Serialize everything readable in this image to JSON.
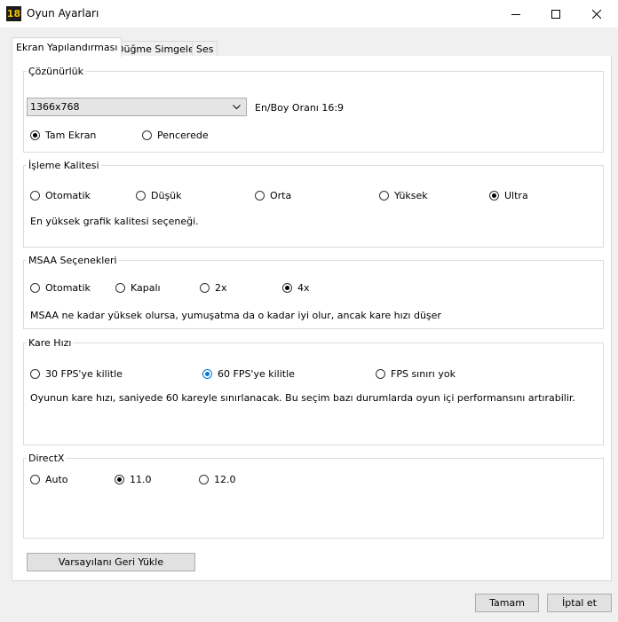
{
  "window": {
    "title": "Oyun Ayarları",
    "icon_text": "18",
    "controls": [
      "minimize-icon",
      "maximize-icon",
      "close-icon"
    ]
  },
  "tabs": [
    {
      "label": "Ekran Yapılandırması",
      "active": true
    },
    {
      "label": "Düğme Simgeleri",
      "active": false
    },
    {
      "label": "Ses",
      "active": false
    }
  ],
  "resolution": {
    "group_label": "Çözünürlük",
    "selected": "1366x768",
    "aspect_ratio": "En/Boy Oranı 16:9",
    "modes": [
      {
        "label": "Tam Ekran",
        "checked": true
      },
      {
        "label": "Pencerede",
        "checked": false
      }
    ]
  },
  "quality": {
    "group_label": "İşleme Kalitesi",
    "options": [
      {
        "label": "Otomatik",
        "checked": false
      },
      {
        "label": "Düşük",
        "checked": false
      },
      {
        "label": "Orta",
        "checked": false
      },
      {
        "label": "Yüksek",
        "checked": false
      },
      {
        "label": "Ultra",
        "checked": true
      }
    ],
    "description": "En yüksek grafik kalitesi seçeneği."
  },
  "msaa": {
    "group_label": "MSAA Seçenekleri",
    "options": [
      {
        "label": "Otomatik",
        "checked": false
      },
      {
        "label": "Kapalı",
        "checked": false
      },
      {
        "label": "2x",
        "checked": false
      },
      {
        "label": "4x",
        "checked": true
      }
    ],
    "description": "MSAA ne kadar yüksek olursa, yumuşatma da o kadar iyi olur, ancak kare hızı düşer"
  },
  "framerate": {
    "group_label": "Kare Hızı",
    "options": [
      {
        "label": "30 FPS'ye kilitle",
        "checked": false
      },
      {
        "label": "60 FPS'ye kilitle",
        "checked": true
      },
      {
        "label": "FPS sınırı yok",
        "checked": false
      }
    ],
    "description": "Oyunun kare hızı, saniyede 60 kareyle sınırlanacak. Bu seçim bazı durumlarda oyun içi performansını artırabilir."
  },
  "directx": {
    "group_label": "DirectX",
    "options": [
      {
        "label": "Auto",
        "checked": false
      },
      {
        "label": "11.0",
        "checked": true
      },
      {
        "label": "12.0",
        "checked": false
      }
    ]
  },
  "buttons": {
    "reset": "Varsayılanı Geri Yükle",
    "ok": "Tamam",
    "cancel": "İptal et"
  }
}
